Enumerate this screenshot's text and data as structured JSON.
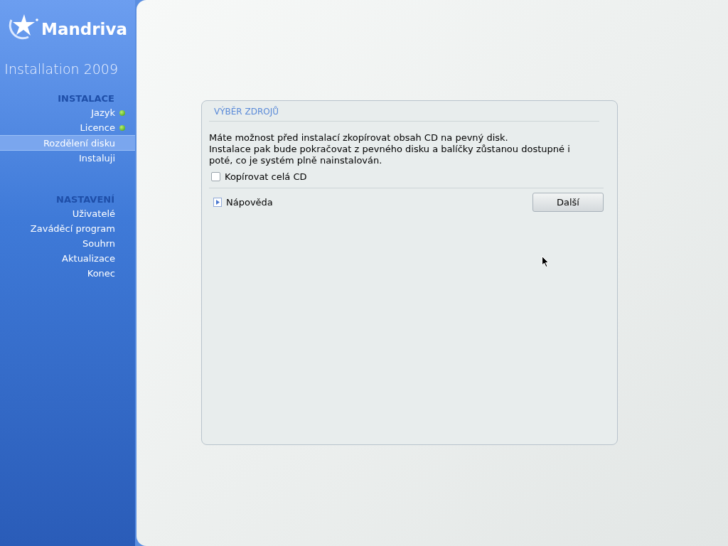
{
  "sidebar": {
    "logo": "Mandriva",
    "subtitle": "Installation 2009",
    "sections": [
      {
        "title": "INSTALACE",
        "items": [
          {
            "label": "Jazyk",
            "done": true,
            "selected": false
          },
          {
            "label": "Licence",
            "done": true,
            "selected": false
          },
          {
            "label": "Rozdělení disku",
            "done": false,
            "selected": true
          },
          {
            "label": "Instaluji",
            "done": false,
            "selected": false
          }
        ]
      },
      {
        "title": "NASTAVENÍ",
        "items": [
          {
            "label": "Uživatelé",
            "done": false,
            "selected": false
          },
          {
            "label": "Zaváděcí program",
            "done": false,
            "selected": false
          },
          {
            "label": "Souhrn",
            "done": false,
            "selected": false
          },
          {
            "label": "Aktualizace",
            "done": false,
            "selected": false
          },
          {
            "label": "Konec",
            "done": false,
            "selected": false
          }
        ]
      }
    ]
  },
  "dialog": {
    "title": "VÝBĚR ZDROJŮ",
    "description": [
      "Máte možnost před instalací zkopírovat obsah CD na pevný disk.",
      "Instalace pak bude pokračovat z pevného disku a balíčky zůstanou dostupné i",
      "poté, co je systém plně nainstalován."
    ],
    "checkbox": {
      "label": "Kopírovat celá CD",
      "checked": false
    },
    "help": {
      "label": "Nápověda",
      "expanded": false
    },
    "next_button": "Další"
  }
}
